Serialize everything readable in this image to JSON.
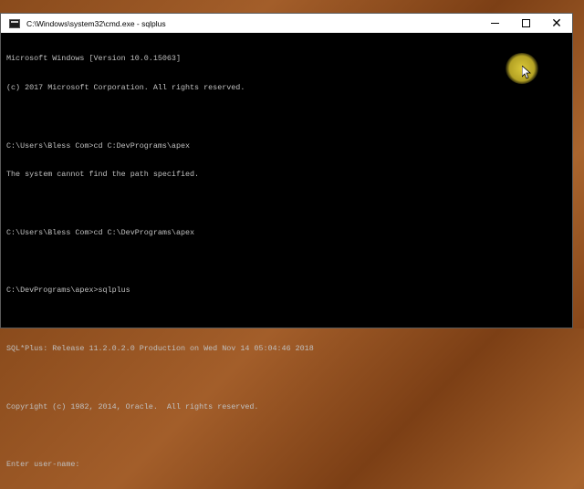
{
  "window": {
    "title": "C:\\Windows\\system32\\cmd.exe - sqlplus",
    "controls": {
      "minimize": "minimize",
      "maximize": "maximize",
      "close": "✕"
    }
  },
  "console": {
    "lines": [
      "Microsoft Windows [Version 10.0.15063]",
      "(c) 2017 Microsoft Corporation. All rights reserved.",
      "",
      "C:\\Users\\Bless Com>cd C:DevPrograms\\apex",
      "The system cannot find the path specified.",
      "",
      "C:\\Users\\Bless Com>cd C:\\DevPrograms\\apex",
      "",
      "C:\\DevPrograms\\apex>sqlplus",
      "",
      "SQL*Plus: Release 11.2.0.2.0 Production on Wed Nov 14 05:04:46 2018",
      "",
      "Copyright (c) 1982, 2014, Oracle.  All rights reserved.",
      "",
      "Enter user-name:"
    ]
  },
  "colors": {
    "console_bg": "#000000",
    "console_text": "#c0c0c0",
    "titlebar_bg": "#ffffff",
    "cursor_highlight": "#e6d23c",
    "desktop": "#9a5524"
  }
}
